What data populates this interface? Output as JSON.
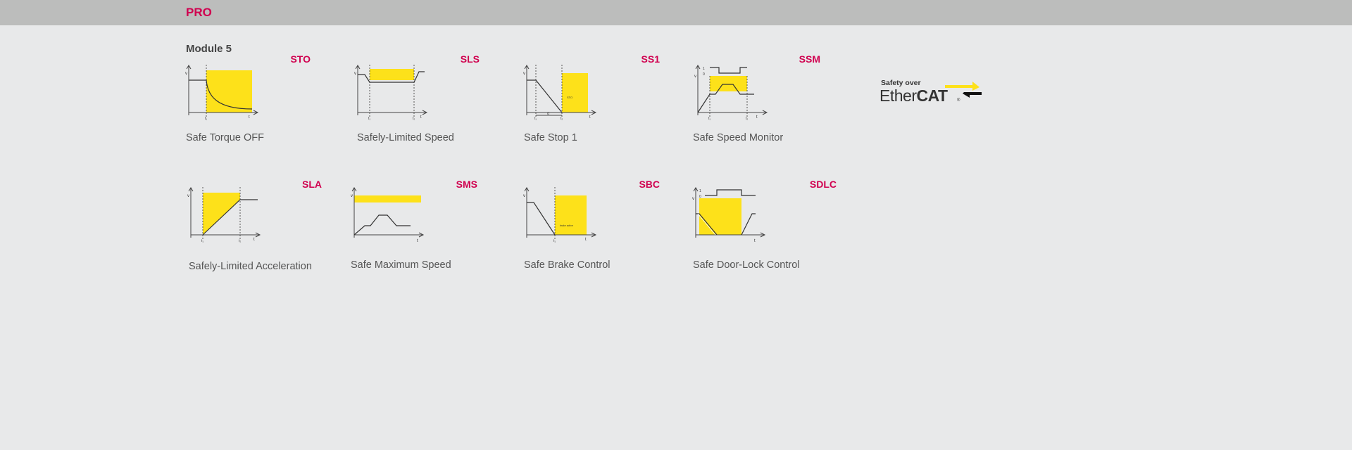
{
  "header": {
    "title": "PRO"
  },
  "section": {
    "title": "Module 5"
  },
  "axis": {
    "v": "v",
    "t": "t",
    "t1": "t₁",
    "t2": "t₂",
    "one": "1",
    "zero": "0",
    "d": "d"
  },
  "functions": [
    {
      "code": "STO",
      "caption": "Safe Torque OFF",
      "inner": ""
    },
    {
      "code": "SLS",
      "caption": "Safely-Limited Speed",
      "inner": ""
    },
    {
      "code": "SS1",
      "caption": "Safe Stop 1",
      "inner": "STO"
    },
    {
      "code": "SSM",
      "caption": "Safe Speed Monitor",
      "inner": ""
    },
    {
      "code": "SLA",
      "caption": "Safely-Limited Acceleration",
      "inner": ""
    },
    {
      "code": "SMS",
      "caption": "Safe Maximum Speed",
      "inner": ""
    },
    {
      "code": "SBC",
      "caption": "Safe Brake Control",
      "inner": "brake active"
    },
    {
      "code": "SDLC",
      "caption": "Safe Door-Lock Control",
      "inner": ""
    }
  ],
  "logo": {
    "line1": "Safety over",
    "line2a": "Ether",
    "line2b": "CAT",
    "reg": "®"
  },
  "colors": {
    "accent": "#d0004f",
    "highlight": "#fde11a",
    "header": "#bcbdbc",
    "background": "#e8e9ea"
  }
}
